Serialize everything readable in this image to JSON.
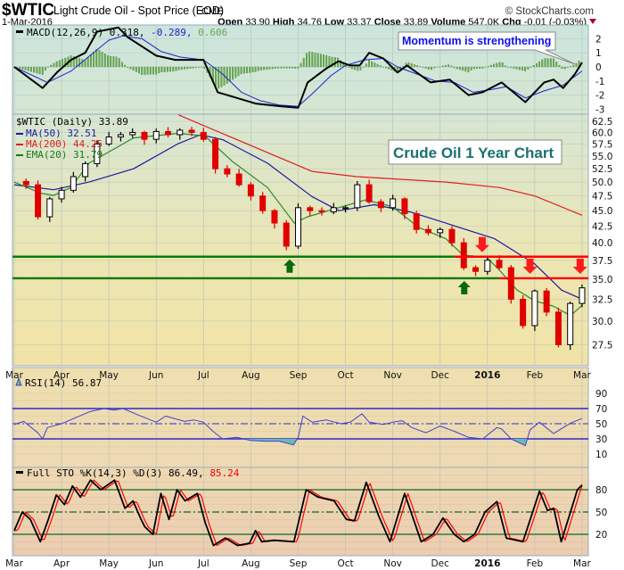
{
  "header": {
    "symbol": "$WTIC",
    "name": "Light Crude Oil - Spot Price (EOD)",
    "exchange": "CME",
    "copyright": "© StockCharts.com",
    "date": "1-Mar-2016",
    "open_label": "Open",
    "open": "33.90",
    "high_label": "High",
    "high": "34.76",
    "low_label": "Low",
    "low": "33.37",
    "close_label": "Close",
    "close": "33.89",
    "volume_label": "Volume",
    "volume": "547.0K",
    "chg_label": "Chg",
    "chg": "-0.01 (-0.03%)",
    "chg_icon": "triangle-down-icon",
    "down_color": "#b0003a"
  },
  "colors": {
    "up_candle": "#000000",
    "down_candle": "#e00000",
    "ma50": "#1a1aa0",
    "ma200": "#e02020",
    "ema20": "#2a8a2a",
    "support": "#0a7a0a",
    "resistance": "#ff0000",
    "macd": "#000000",
    "signal": "#2020d0",
    "histogram": "#6aa84f",
    "rsi": "#4040d0",
    "sto_k": "#000000",
    "sto_d": "#ff0000",
    "title_callout": "#1a7070",
    "momentum_callout": "#1010ee"
  },
  "annotations": {
    "chart_title": "Crude Oil 1 Year Chart",
    "momentum": "Momentum is strengthening"
  },
  "chart_data": [
    {
      "type": "line",
      "panel": "macd",
      "legend": {
        "label": "MACD(12,26,9)",
        "macd": "0.318,",
        "signal": "-0.289,",
        "histogram": "0.606"
      },
      "y_ticks": [
        "2",
        "1",
        "0",
        "-1",
        "-2",
        "-3"
      ],
      "ylim": [
        -3.3,
        3.0
      ],
      "x_unit": "months since 1-Mar-2015",
      "macd": [
        [
          0,
          0
        ],
        [
          0.6,
          -1.5
        ],
        [
          0.9,
          -0.4
        ],
        [
          1.2,
          0.5
        ],
        [
          1.5,
          1.0
        ],
        [
          1.75,
          2.5
        ],
        [
          2.2,
          2.8
        ],
        [
          2.4,
          2.1
        ],
        [
          3.0,
          0.8
        ],
        [
          3.4,
          0.5
        ],
        [
          4.0,
          0.5
        ],
        [
          4.3,
          -1.8
        ],
        [
          4.8,
          -2.3
        ],
        [
          5.1,
          -2.6
        ],
        [
          5.65,
          -2.8
        ],
        [
          6.0,
          -2.9
        ],
        [
          6.2,
          -1.1
        ],
        [
          6.6,
          -0.1
        ],
        [
          6.85,
          0.4
        ],
        [
          7.1,
          0.1
        ],
        [
          7.3,
          0.1
        ],
        [
          7.5,
          1.0
        ],
        [
          7.8,
          0.6
        ],
        [
          8.1,
          -0.4
        ],
        [
          8.3,
          0.1
        ],
        [
          8.8,
          -1.1
        ],
        [
          9.2,
          -0.9
        ],
        [
          9.6,
          -2.0
        ],
        [
          9.9,
          -1.8
        ],
        [
          10.3,
          -1.1
        ],
        [
          10.8,
          -2.5
        ],
        [
          11.2,
          -1.1
        ],
        [
          11.4,
          -0.9
        ],
        [
          11.6,
          -1.5
        ],
        [
          11.85,
          -0.5
        ],
        [
          12,
          0.318
        ]
      ],
      "signal": [
        [
          0,
          0
        ],
        [
          0.7,
          -1.1
        ],
        [
          1.2,
          -0.3
        ],
        [
          1.6,
          0.8
        ],
        [
          2.0,
          1.9
        ],
        [
          2.3,
          2.2
        ],
        [
          2.7,
          2.0
        ],
        [
          3.1,
          1.1
        ],
        [
          3.5,
          0.7
        ],
        [
          4.0,
          0.5
        ],
        [
          4.4,
          -0.5
        ],
        [
          4.8,
          -1.8
        ],
        [
          5.2,
          -2.4
        ],
        [
          5.6,
          -2.7
        ],
        [
          6.0,
          -2.8
        ],
        [
          6.3,
          -1.9
        ],
        [
          6.7,
          -0.6
        ],
        [
          7.0,
          0.1
        ],
        [
          7.4,
          0.5
        ],
        [
          7.8,
          0.6
        ],
        [
          8.1,
          0.0
        ],
        [
          8.5,
          -0.5
        ],
        [
          8.9,
          -1.0
        ],
        [
          9.3,
          -1.1
        ],
        [
          9.7,
          -1.8
        ],
        [
          10.1,
          -1.6
        ],
        [
          10.4,
          -1.4
        ],
        [
          10.8,
          -2.2
        ],
        [
          11.2,
          -1.7
        ],
        [
          11.6,
          -1.3
        ],
        [
          12,
          -0.289
        ]
      ]
    },
    {
      "type": "candlestick",
      "panel": "price",
      "legend": {
        "symbol": "$WTIC (Daily) 33.89",
        "ma50": "MA(50) 32.51",
        "ma200": "MA(200) 44.25",
        "ema20": "EMA(20) 31.79"
      },
      "y_ticks": [
        "62.5",
        "60.0",
        "57.5",
        "55.0",
        "52.5",
        "50.0",
        "47.5",
        "45.0",
        "42.5",
        "40.0",
        "37.5",
        "35.0",
        "32.5",
        "30.0",
        "27.5"
      ],
      "scale": "log",
      "ylim": [
        25.5,
        64
      ],
      "x_ticks": [
        "Mar",
        "Apr",
        "May",
        "Jun",
        "Jul",
        "Aug",
        "Sep",
        "Oct",
        "Nov",
        "Dec",
        "2016",
        "Feb",
        "Mar"
      ],
      "close_step_months": 0.25,
      "closes": [
        50.1,
        49.5,
        44.0,
        47.0,
        48.5,
        51.0,
        53.5,
        57.5,
        59.0,
        59.5,
        60.0,
        58.5,
        60.2,
        59.5,
        60.5,
        60.0,
        58.5,
        52.5,
        51.5,
        49.5,
        47.5,
        45.0,
        43.0,
        39.5,
        45.5,
        45.0,
        44.8,
        45.5,
        45.5,
        49.5,
        46.5,
        45.5,
        47.0,
        44.5,
        42.0,
        41.5,
        42.0,
        40.0,
        36.5,
        36.0,
        37.5,
        36.5,
        32.5,
        29.5,
        33.5,
        31.0,
        27.5,
        32.0,
        33.89
      ],
      "ma50": [
        [
          0,
          49.5
        ],
        [
          0.83,
          48.6
        ],
        [
          1.58,
          50
        ],
        [
          2.52,
          52.5
        ],
        [
          3.47,
          57.6
        ],
        [
          3.94,
          59.5
        ],
        [
          4.41,
          58.4
        ],
        [
          5.35,
          53.6
        ],
        [
          6.29,
          47.4
        ],
        [
          6.86,
          45
        ],
        [
          7.61,
          46
        ],
        [
          8.37,
          44.8
        ],
        [
          9.12,
          43
        ],
        [
          10.15,
          40.6
        ],
        [
          11.0,
          37
        ],
        [
          11.57,
          33.6
        ],
        [
          12,
          32.51
        ]
      ],
      "ma200": [
        [
          3.47,
          64
        ],
        [
          6.29,
          52
        ],
        [
          7.23,
          51
        ],
        [
          9.12,
          50
        ],
        [
          10.25,
          49
        ],
        [
          11.0,
          47.5
        ],
        [
          12,
          44.25
        ]
      ],
      "ema20": [
        [
          0,
          50
        ],
        [
          0.55,
          48
        ],
        [
          0.83,
          47.6
        ],
        [
          1.2,
          49
        ],
        [
          1.58,
          53.6
        ],
        [
          2.52,
          58.8
        ],
        [
          3.47,
          59.8
        ],
        [
          4.03,
          59.2
        ],
        [
          4.6,
          54
        ],
        [
          5.35,
          49
        ],
        [
          5.92,
          43
        ],
        [
          6.2,
          44
        ],
        [
          6.86,
          45.5
        ],
        [
          7.42,
          46.8
        ],
        [
          7.99,
          45.7
        ],
        [
          8.55,
          42.3
        ],
        [
          9.12,
          40.6
        ],
        [
          9.49,
          38.2
        ],
        [
          9.97,
          38
        ],
        [
          10.25,
          36.2
        ],
        [
          10.63,
          33.6
        ],
        [
          11.0,
          32.3
        ],
        [
          11.38,
          31.7
        ],
        [
          11.76,
          30.6
        ],
        [
          12,
          31.79
        ]
      ],
      "support_lines": [
        {
          "price": 38.0,
          "until_month": 9.3
        },
        {
          "price": 35.1,
          "until_month": 10.25
        }
      ],
      "resistance_lines": [
        {
          "price": 38.0,
          "from_month": 9.3
        },
        {
          "price": 35.1,
          "from_month": 10.25
        }
      ],
      "up_arrows": [
        [
          5.82,
          38.0
        ],
        [
          9.51,
          35.1
        ]
      ],
      "down_arrows": [
        [
          9.89,
          38.0
        ],
        [
          10.9,
          35.1
        ],
        [
          11.96,
          35.1
        ]
      ]
    },
    {
      "type": "line",
      "panel": "rsi",
      "legend": "RSI(14) 56.87",
      "y_ticks": [
        "90",
        "70",
        "50",
        "30",
        "10"
      ],
      "levels": [
        70,
        50,
        30
      ],
      "values": [
        [
          0,
          49
        ],
        [
          0.2,
          53
        ],
        [
          0.5,
          38
        ],
        [
          0.6,
          30
        ],
        [
          0.7,
          45
        ],
        [
          1.0,
          50
        ],
        [
          1.3,
          58
        ],
        [
          1.6,
          66
        ],
        [
          1.9,
          70
        ],
        [
          2.1,
          68
        ],
        [
          2.3,
          70
        ],
        [
          2.6,
          62
        ],
        [
          3.0,
          52
        ],
        [
          3.2,
          60
        ],
        [
          3.6,
          53
        ],
        [
          3.8,
          55
        ],
        [
          4.0,
          52
        ],
        [
          4.2,
          40
        ],
        [
          4.4,
          30
        ],
        [
          4.7,
          32
        ],
        [
          5.0,
          28
        ],
        [
          5.3,
          27
        ],
        [
          5.6,
          27
        ],
        [
          5.9,
          22
        ],
        [
          6.0,
          32
        ],
        [
          6.1,
          60
        ],
        [
          6.3,
          52
        ],
        [
          6.6,
          55
        ],
        [
          6.9,
          50
        ],
        [
          7.1,
          52
        ],
        [
          7.35,
          63
        ],
        [
          7.5,
          52
        ],
        [
          7.8,
          49
        ],
        [
          8.0,
          52
        ],
        [
          8.2,
          54
        ],
        [
          8.4,
          45
        ],
        [
          8.7,
          38
        ],
        [
          9.0,
          47
        ],
        [
          9.3,
          40
        ],
        [
          9.6,
          32
        ],
        [
          9.9,
          30
        ],
        [
          10.2,
          45
        ],
        [
          10.3,
          43
        ],
        [
          10.5,
          30
        ],
        [
          10.7,
          24
        ],
        [
          10.8,
          21
        ],
        [
          10.9,
          42
        ],
        [
          11.1,
          52
        ],
        [
          11.4,
          37
        ],
        [
          11.6,
          45
        ],
        [
          11.8,
          52
        ],
        [
          12,
          56.87
        ]
      ]
    },
    {
      "type": "line",
      "panel": "stochastic",
      "legend": {
        "label": "Full STO %K(14,3) %D(3) 86.49,",
        "d": "85.24"
      },
      "y_ticks": [
        "80",
        "50",
        "20"
      ],
      "levels": [
        80,
        50,
        20
      ],
      "k": [
        [
          0,
          25
        ],
        [
          0.17,
          50
        ],
        [
          0.34,
          40
        ],
        [
          0.55,
          10
        ],
        [
          0.72,
          40
        ],
        [
          0.89,
          73
        ],
        [
          1.06,
          60
        ],
        [
          1.23,
          85
        ],
        [
          1.4,
          70
        ],
        [
          1.61,
          93
        ],
        [
          1.83,
          80
        ],
        [
          2.12,
          93
        ],
        [
          2.34,
          55
        ],
        [
          2.51,
          65
        ],
        [
          2.68,
          40
        ],
        [
          2.76,
          30
        ],
        [
          2.93,
          20
        ],
        [
          3.1,
          75
        ],
        [
          3.27,
          40
        ],
        [
          3.44,
          80
        ],
        [
          3.61,
          65
        ],
        [
          3.87,
          75
        ],
        [
          4.04,
          35
        ],
        [
          4.21,
          5
        ],
        [
          4.46,
          15
        ],
        [
          4.72,
          5
        ],
        [
          4.97,
          8
        ],
        [
          5.1,
          25
        ],
        [
          5.23,
          10
        ],
        [
          5.49,
          12
        ],
        [
          5.91,
          10
        ],
        [
          6.17,
          80
        ],
        [
          6.42,
          70
        ],
        [
          6.76,
          65
        ],
        [
          7.02,
          40
        ],
        [
          7.19,
          38
        ],
        [
          7.44,
          90
        ],
        [
          7.7,
          45
        ],
        [
          7.94,
          10
        ],
        [
          8.25,
          75
        ],
        [
          8.6,
          10
        ],
        [
          8.85,
          20
        ],
        [
          9.06,
          42
        ],
        [
          9.3,
          20
        ],
        [
          9.5,
          10
        ],
        [
          9.73,
          20
        ],
        [
          9.95,
          50
        ],
        [
          10.2,
          64
        ],
        [
          10.4,
          15
        ],
        [
          10.75,
          10
        ],
        [
          11.1,
          78
        ],
        [
          11.27,
          52
        ],
        [
          11.4,
          55
        ],
        [
          11.56,
          10
        ],
        [
          11.9,
          80
        ],
        [
          12,
          86.49
        ]
      ],
      "d_final": 85.24
    }
  ]
}
